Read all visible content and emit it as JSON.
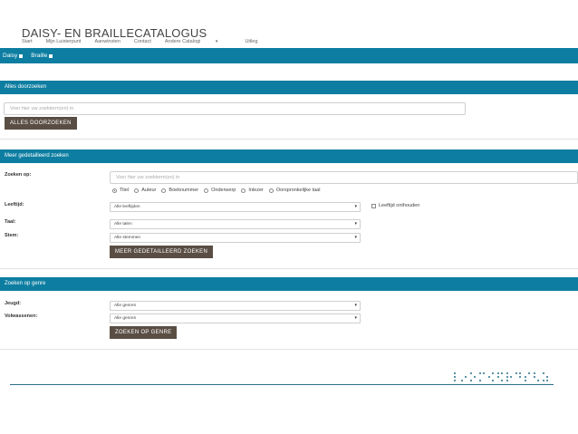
{
  "header": {
    "title": "DAISY- EN BRAILLECATALOGUS",
    "nav": [
      {
        "label": "Start"
      },
      {
        "label": "Mijn Luisterpunt"
      },
      {
        "label": "Aanwinsten"
      },
      {
        "label": "Contact"
      },
      {
        "label": "Andere Catalogi",
        "caret": "▾"
      },
      {
        "label": "Uitleg"
      }
    ]
  },
  "formats": [
    {
      "label": "Daisy"
    },
    {
      "label": "Braille"
    }
  ],
  "search_all": {
    "heading": "Alles doorzoeken",
    "input_placeholder": "Voer hier uw zoekterm(en) in",
    "input_value": "",
    "button_label": "ALLES DOORZOEKEN"
  },
  "detailed": {
    "heading": "Meer gedetailleerd zoeken",
    "search_label": "Zoeken op:",
    "input_placeholder": "Voer hier uw zoekterm(en) in",
    "input_value": "",
    "radios": [
      {
        "label": "Titel",
        "checked": true
      },
      {
        "label": "Auteur",
        "checked": false
      },
      {
        "label": "Boeknummer",
        "checked": false
      },
      {
        "label": "Onderwerp",
        "checked": false
      },
      {
        "label": "Inlezer",
        "checked": false
      },
      {
        "label": "Oorspronkelijke taal",
        "checked": false
      }
    ],
    "age_label": "Leeftijd:",
    "age_value": "Alle leeftijden",
    "remember_label": "Leeftijd onthouden",
    "language_label": "Taal:",
    "language_value": "Alle talen",
    "voice_label": "Stem:",
    "voice_value": "Alle stemmen",
    "button_label": "MEER GEDETAILLEERD ZOEKEN"
  },
  "genre": {
    "heading": "Zoeken op genre",
    "youth_label": "Jeugd:",
    "youth_value": "Alle genres",
    "adults_label": "Volwassenen:",
    "adults_value": "Alle genres",
    "button_label": "ZOEKEN OP GENRE"
  },
  "colors": {
    "accent": "#0d7ea1",
    "button": "#5a4e44"
  },
  "icons": {
    "select_arrow": "▾"
  }
}
